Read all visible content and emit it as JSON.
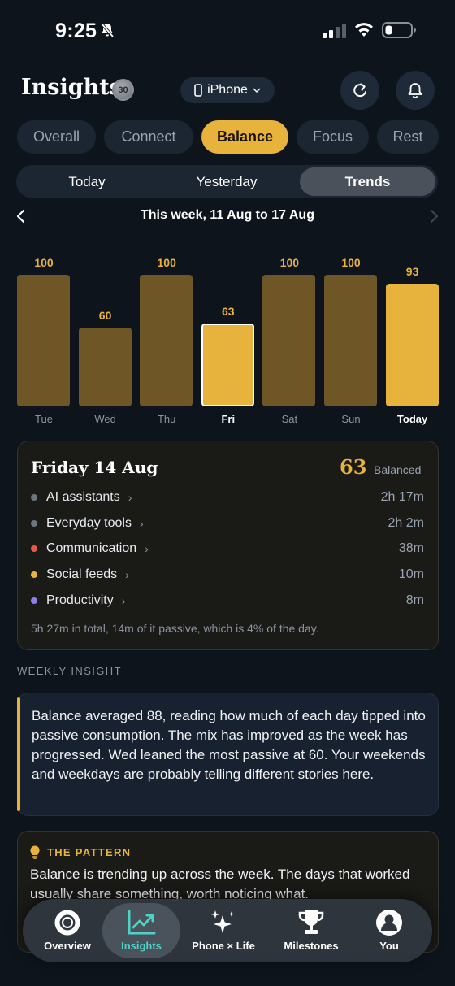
{
  "status_bar": {
    "time": "9:25"
  },
  "header": {
    "title": "Insights",
    "badge": "30",
    "device_label": "iPhone"
  },
  "tabs": [
    {
      "label": "Overall",
      "active": false
    },
    {
      "label": "Connect",
      "active": false
    },
    {
      "label": "Balance",
      "active": true
    },
    {
      "label": "Focus",
      "active": false
    },
    {
      "label": "Rest",
      "active": false
    }
  ],
  "range_tabs": [
    {
      "label": "Today",
      "active": false
    },
    {
      "label": "Yesterday",
      "active": false
    },
    {
      "label": "Trends",
      "active": true
    }
  ],
  "week_label": "This week, 11 Aug to 17 Aug",
  "chart_data": {
    "type": "bar",
    "categories": [
      "Tue",
      "Wed",
      "Thu",
      "Fri",
      "Sat",
      "Sun",
      "Today"
    ],
    "values": [
      100,
      60,
      100,
      63,
      100,
      100,
      93
    ],
    "selected": "Fri",
    "ylim": [
      0,
      100
    ]
  },
  "day_detail": {
    "title": "Friday 14 Aug",
    "score": "63",
    "status": "Balanced",
    "categories": [
      {
        "name": "AI assistants",
        "time": "2h 17m",
        "color": "#6b7580"
      },
      {
        "name": "Everyday tools",
        "time": "2h 2m",
        "color": "#6b7580"
      },
      {
        "name": "Communication",
        "time": "38m",
        "color": "#e8584a"
      },
      {
        "name": "Social feeds",
        "time": "10m",
        "color": "#e8b33c"
      },
      {
        "name": "Productivity",
        "time": "8m",
        "color": "#8b7fe8"
      }
    ],
    "summary": "5h 27m in total, 14m of it passive, which is 4% of the day."
  },
  "weekly_insight": {
    "label": "WEEKLY INSIGHT",
    "text": "Balance averaged 88, reading how much of each day tipped into passive consumption. The mix has improved as the week has progressed. Wed leaned the most passive at 60. Your weekends and weekdays are probably telling different stories here."
  },
  "pattern": {
    "label": "THE PATTERN",
    "text": "Balance is trending up across the week. The days that worked usually share something, worth noticing what."
  },
  "bottom_nav": [
    {
      "label": "Overview",
      "icon": "overview-icon",
      "active": false
    },
    {
      "label": "Insights",
      "icon": "trend-chart-icon",
      "active": true
    },
    {
      "label": "Phone × Life",
      "icon": "sparkles-icon",
      "active": false
    },
    {
      "label": "Milestones",
      "icon": "trophy-icon",
      "active": false
    },
    {
      "label": "You",
      "icon": "profile-icon",
      "active": false
    }
  ],
  "colors": {
    "accent": "#e8b33c",
    "bar_dim": "#6e5627",
    "nav_active": "#4fd1c5",
    "background": "#0e141c"
  }
}
